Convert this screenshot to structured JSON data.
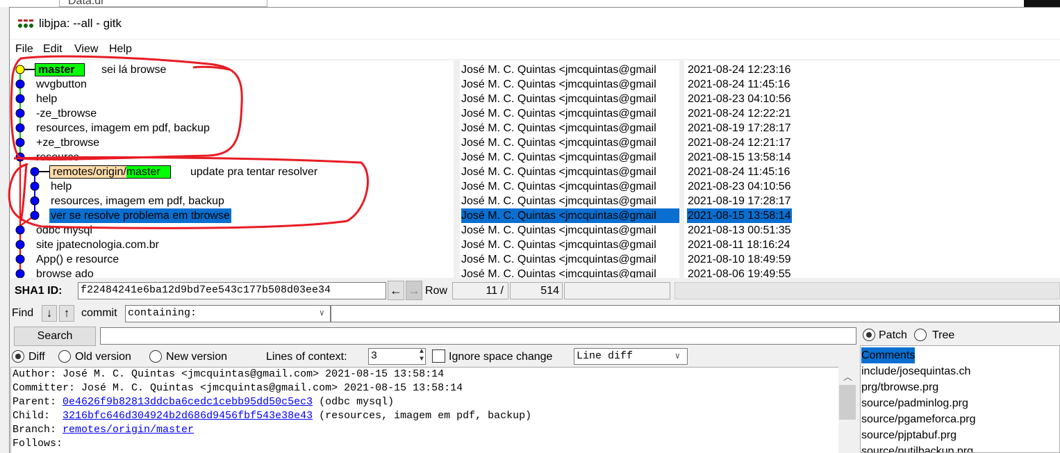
{
  "background_window": {
    "tab_label": "Data.dl"
  },
  "window": {
    "title": "libjpa: --all - gitk"
  },
  "menu": [
    "File",
    "Edit",
    "View",
    "Help"
  ],
  "commits": [
    {
      "msg": "sei lá browse",
      "author": "José M. C. Quintas <jmcquintas@gmail",
      "date": "2021-08-24 12:23:16",
      "col": 0,
      "head": true,
      "refs": [
        {
          "label": "master",
          "type": "head"
        }
      ]
    },
    {
      "msg": "wvgbutton",
      "author": "José M. C. Quintas <jmcquintas@gmail",
      "date": "2021-08-24 11:45:16",
      "col": 0
    },
    {
      "msg": "help",
      "author": "José M. C. Quintas <jmcquintas@gmail",
      "date": "2021-08-23 04:10:56",
      "col": 0
    },
    {
      "msg": "-ze_tbrowse",
      "author": "José M. C. Quintas <jmcquintas@gmail",
      "date": "2021-08-24 12:22:21",
      "col": 0
    },
    {
      "msg": "resources, imagem em pdf, backup",
      "author": "José M. C. Quintas <jmcquintas@gmail",
      "date": "2021-08-19 17:28:17",
      "col": 0
    },
    {
      "msg": "+ze_tbrowse",
      "author": "José M. C. Quintas <jmcquintas@gmail",
      "date": "2021-08-24 12:21:17",
      "col": 0
    },
    {
      "msg": "resource",
      "author": "José M. C. Quintas <jmcquintas@gmail",
      "date": "2021-08-15 13:58:14",
      "col": 0
    },
    {
      "msg": "update pra tentar resolver",
      "author": "José M. C. Quintas <jmcquintas@gmail",
      "date": "2021-08-24 11:45:16",
      "col": 1,
      "refs": [
        {
          "label": "remotes/origin/",
          "type": "remote"
        },
        {
          "label": "master",
          "type": "head"
        }
      ]
    },
    {
      "msg": "help",
      "author": "José M. C. Quintas <jmcquintas@gmail",
      "date": "2021-08-23 04:10:56",
      "col": 1
    },
    {
      "msg": "resources, imagem em pdf, backup",
      "author": "José M. C. Quintas <jmcquintas@gmail",
      "date": "2021-08-19 17:28:17",
      "col": 1
    },
    {
      "msg": "ver se resolve problema em tbrowse",
      "author": "José M. C. Quintas <jmcquintas@gmail",
      "date": "2021-08-15 13:58:14",
      "col": 1,
      "selected": true
    },
    {
      "msg": "odbc mysql",
      "author": "José M. C. Quintas <jmcquintas@gmail",
      "date": "2021-08-13 00:51:35",
      "col": 0
    },
    {
      "msg": "site jpatecnologia.com.br",
      "author": "José M. C. Quintas <jmcquintas@gmail",
      "date": "2021-08-11 18:16:24",
      "col": 0
    },
    {
      "msg": "App() e resource",
      "author": "José M. C. Quintas <jmcquintas@gmail",
      "date": "2021-08-10 18:49:59",
      "col": 0
    },
    {
      "msg": "browse ado",
      "author": "José M. C. Quintas <jmcquintas@gmail",
      "date": "2021-08-06 19:49:55",
      "col": 0
    }
  ],
  "sha": {
    "label": "SHA1 ID:",
    "value": "f22484241e6ba12d9bd7ee543c177b508d03ee34",
    "row_label": "Row",
    "row": "11 /",
    "total": "514"
  },
  "find": {
    "label": "Find",
    "commit_label": "commit",
    "mode": "containing:",
    "search_button": "Search",
    "query": ""
  },
  "diff_opts": {
    "diff": "Diff",
    "old": "Old version",
    "new": "New version",
    "context_label": "Lines of context:",
    "context": "3",
    "ignore_space": "Ignore space change",
    "diff_mode": "Line diff"
  },
  "details": {
    "author_label": "Author:",
    "author": "José M. C. Quintas <jmcquintas@gmail.com>  2021-08-15 13:58:14",
    "committer_label": "Committer:",
    "committer": "José M. C. Quintas <jmcquintas@gmail.com>  2021-08-15 13:58:14",
    "parent_label": "Parent:",
    "parent_sha": "0e4626f9b82813ddcba6cedc1cebb95dd50c5ec3",
    "parent_msg": "(odbc mysql)",
    "child_label": "Child:",
    "child_sha": "3216bfc646d304924b2d686d9456fbf543e38e43",
    "child_msg": "(resources, imagem em pdf, backup)",
    "branch_label": "Branch:",
    "branch": "remotes/origin/master",
    "follows_label": "Follows:"
  },
  "files": {
    "patch": "Patch",
    "tree": "Tree",
    "items": [
      "Comments",
      "include/josequintas.ch",
      "prg/tbrowse.prg",
      "source/padminlog.prg",
      "source/pgameforca.prg",
      "source/pjptabuf.prg",
      "source/putilbackup.prg"
    ]
  },
  "colors": {
    "head_tag": "#00ff00",
    "remote_tag": "#ffddaa",
    "node": "#0000ff",
    "head_node": "#ffff00",
    "selection": "#0a6fd0",
    "annotation": "#e81c24"
  }
}
